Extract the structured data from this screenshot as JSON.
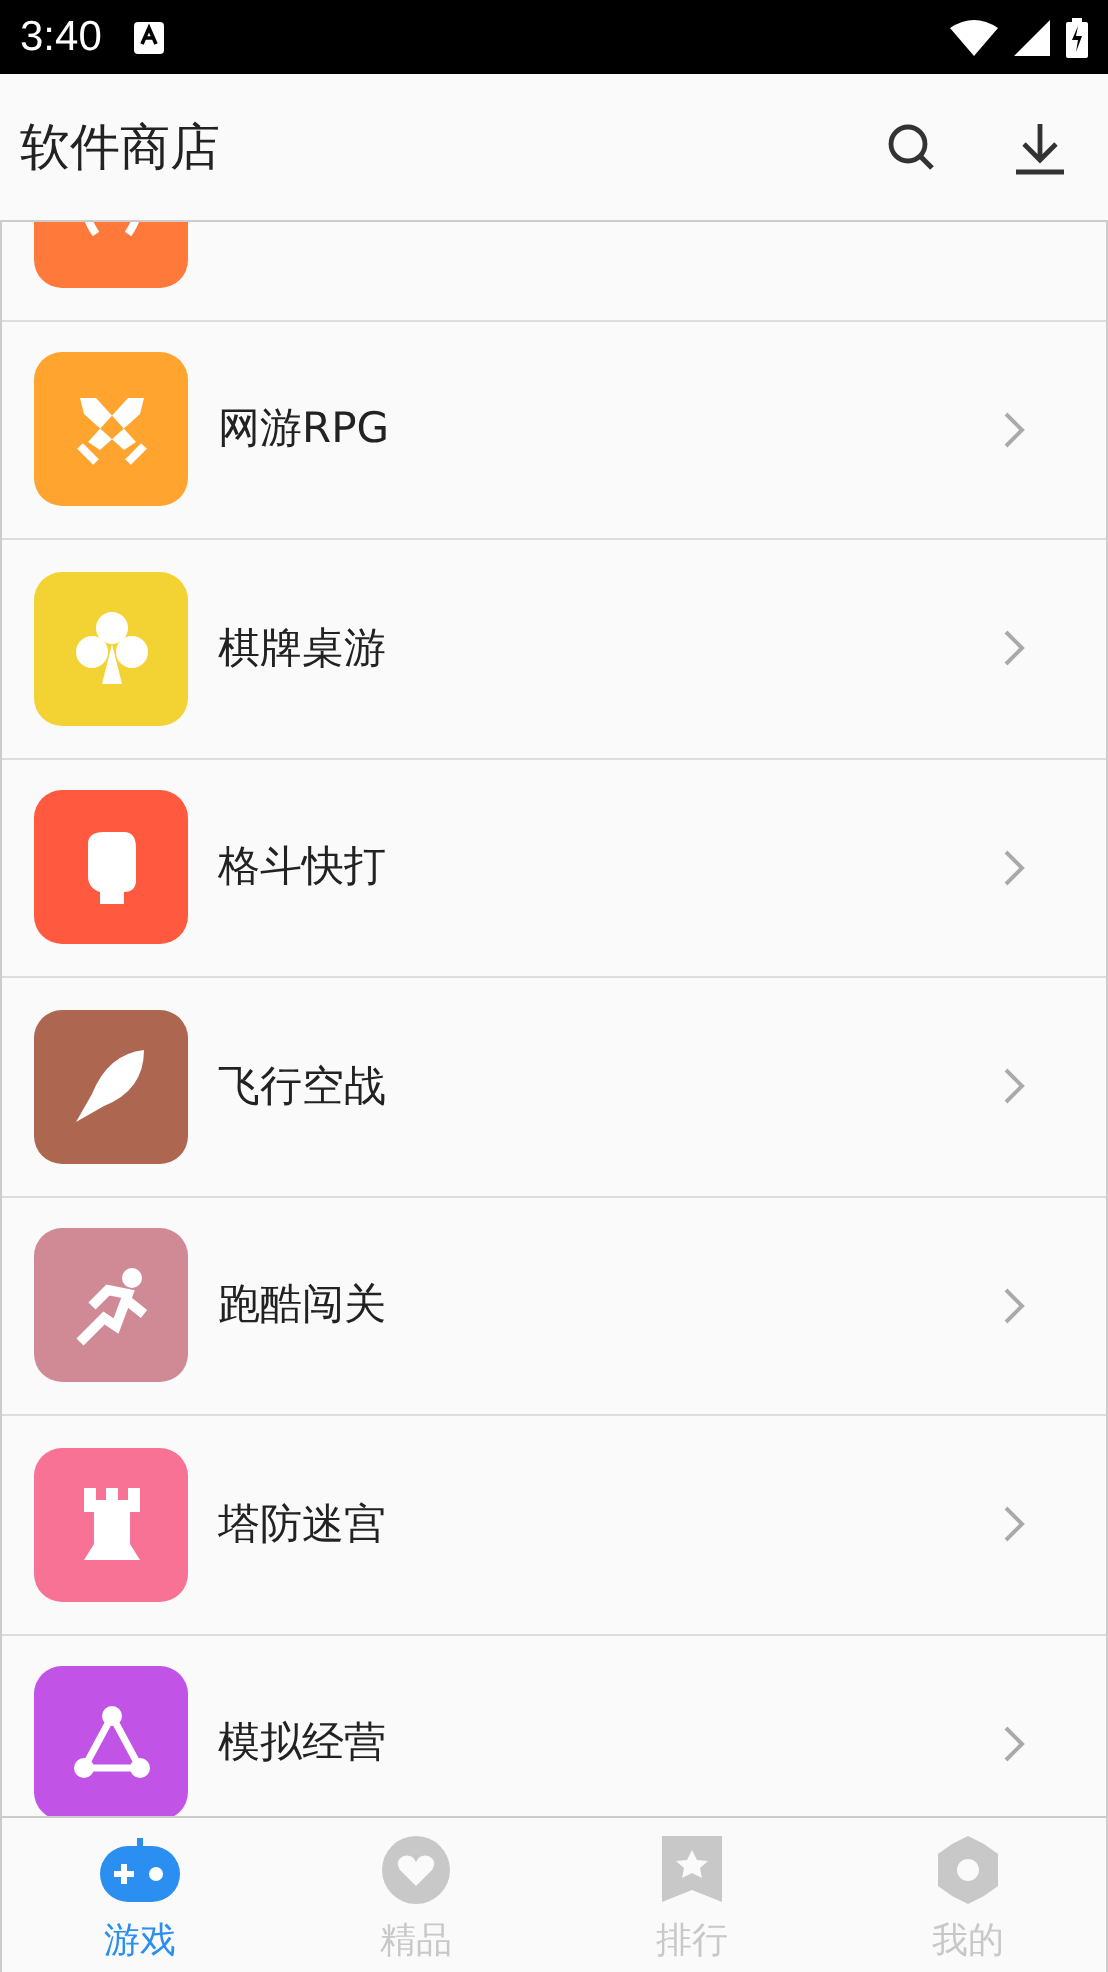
{
  "status_bar": {
    "time": "3:40"
  },
  "app_bar": {
    "title": "软件商店"
  },
  "categories": [
    {
      "color": "#ff7a3a",
      "partial": true
    },
    {
      "label": "网游RPG",
      "color": "#ffa42f"
    },
    {
      "label": "棋牌桌游",
      "color": "#f3d233"
    },
    {
      "label": "格斗快打",
      "color": "#ff5a3f"
    },
    {
      "label": "飞行空战",
      "color": "#ad6650"
    },
    {
      "label": "跑酷闯关",
      "color": "#d08a96"
    },
    {
      "label": "塔防迷宫",
      "color": "#f87296"
    },
    {
      "label": "模拟经营",
      "color": "#c154e6"
    }
  ],
  "bottom_nav": [
    {
      "label": "游戏",
      "selected": true
    },
    {
      "label": "精品",
      "selected": false
    },
    {
      "label": "排行",
      "selected": false
    },
    {
      "label": "我的",
      "selected": false
    }
  ]
}
